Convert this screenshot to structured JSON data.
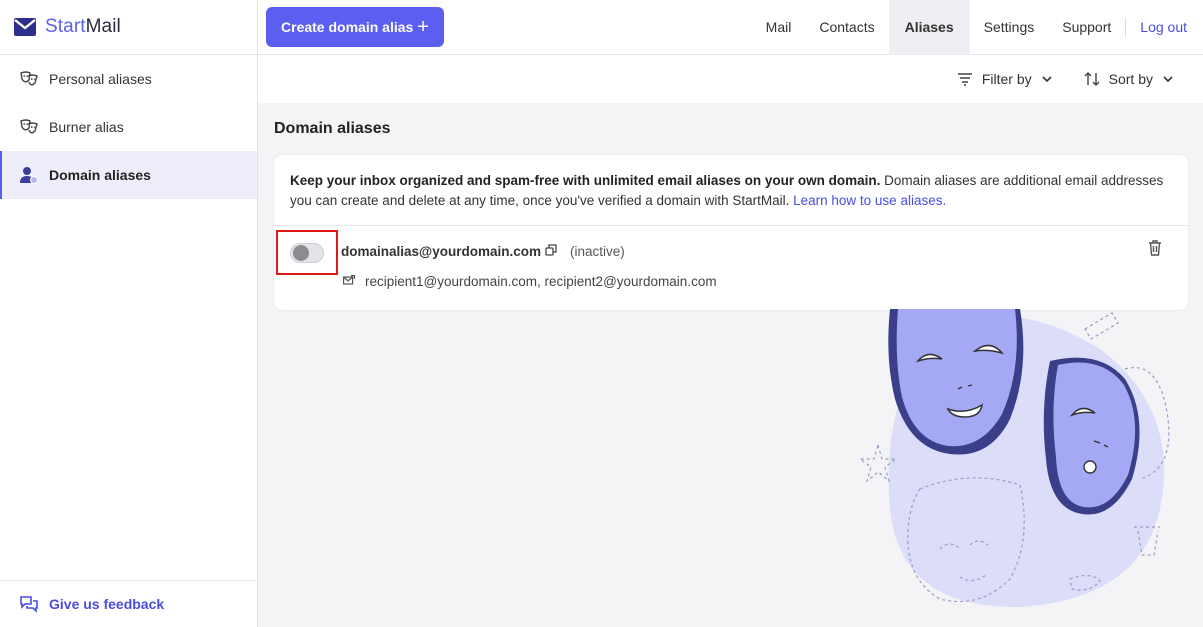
{
  "brand": {
    "name_start": "Start",
    "name_end": "Mail",
    "icon": "envelope-icon"
  },
  "sidebar": {
    "items": [
      {
        "label": "Personal aliases",
        "icon": "masks-icon",
        "active": false
      },
      {
        "label": "Burner alias",
        "icon": "masks-icon",
        "active": false
      },
      {
        "label": "Domain aliases",
        "icon": "user-domain-icon",
        "active": true
      }
    ],
    "feedback_label": "Give us feedback"
  },
  "header": {
    "create_label": "Create domain alias",
    "create_icon": "+",
    "nav": [
      {
        "label": "Mail",
        "active": false
      },
      {
        "label": "Contacts",
        "active": false
      },
      {
        "label": "Aliases",
        "active": true
      },
      {
        "label": "Settings",
        "active": false
      },
      {
        "label": "Support",
        "active": false
      }
    ],
    "logout_label": "Log out"
  },
  "toolbar": {
    "filter_label": "Filter by",
    "sort_label": "Sort by"
  },
  "main": {
    "title": "Domain aliases",
    "intro_bold": "Keep your inbox organized and spam-free with unlimited email aliases on your own domain.",
    "intro_text": " Domain aliases are additional email addresses you can create and delete at any time, once you've verified a domain with StartMail.",
    "intro_link": "Learn how to use aliases.",
    "alias": {
      "email": "domainalias@yourdomain.com",
      "status": "(inactive)",
      "enabled": false,
      "recipients": "recipient1@yourdomain.com, recipient2@yourdomain.com"
    }
  },
  "colors": {
    "accent": "#5b5ef0",
    "link": "#4a4de0",
    "highlight": "#e01818"
  }
}
